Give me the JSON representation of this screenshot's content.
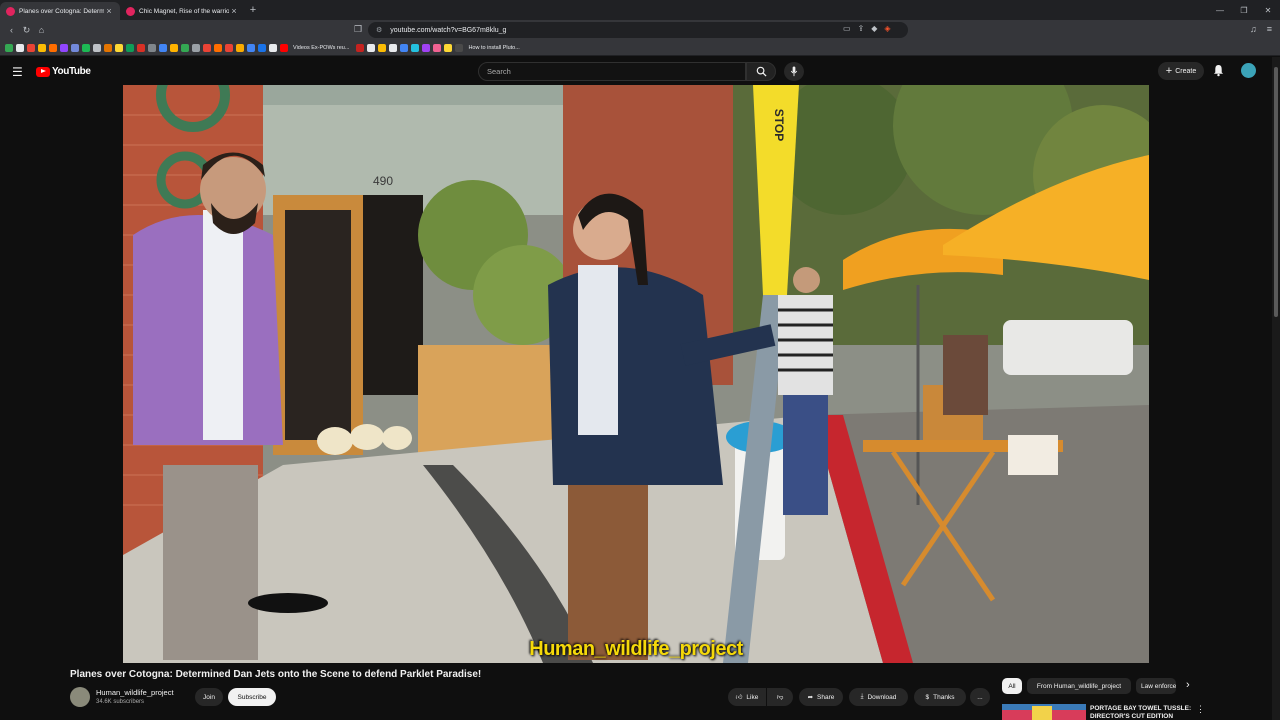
{
  "browser": {
    "tabs": [
      {
        "title": "Planes over Cotogna: Determ",
        "active": true
      },
      {
        "title": "Chic Magnet, Rise of the warrior wor",
        "active": false
      }
    ],
    "new_tab": "+",
    "url": "youtube.com/watch?v=BG67m8klu_g",
    "bookmarks": [
      {
        "label": "",
        "color": "#34a853"
      },
      {
        "label": "",
        "color": "#e8eaed"
      },
      {
        "label": "",
        "color": "#ea4335"
      },
      {
        "label": "",
        "color": "#fbbc04"
      },
      {
        "label": "",
        "color": "#ff6d00"
      },
      {
        "label": "",
        "color": "#9146ff"
      },
      {
        "label": "",
        "color": "#7289da"
      },
      {
        "label": "",
        "color": "#1db954"
      },
      {
        "label": "",
        "color": "#bdc1c6"
      },
      {
        "label": "",
        "color": "#e37400"
      },
      {
        "label": "",
        "color": "#fdd835"
      },
      {
        "label": "",
        "color": "#0f9d58"
      },
      {
        "label": "",
        "color": "#d93025"
      },
      {
        "label": "",
        "color": "#80868b"
      },
      {
        "label": "",
        "color": "#4285f4"
      },
      {
        "label": "",
        "color": "#ffb300"
      },
      {
        "label": "",
        "color": "#34a853"
      },
      {
        "label": "",
        "color": "#9aa0a6"
      },
      {
        "label": "",
        "color": "#ea4335"
      },
      {
        "label": "",
        "color": "#ff6d00"
      },
      {
        "label": "",
        "color": "#ea4335"
      },
      {
        "label": "",
        "color": "#f9ab00"
      },
      {
        "label": "",
        "color": "#4285f4"
      },
      {
        "label": "",
        "color": "#1a73e8"
      },
      {
        "label": "",
        "color": "#e8eaed"
      },
      {
        "label": "Videos Ex-POWs reu...",
        "color": "#ff0000"
      },
      {
        "label": "",
        "color": "#c5221f"
      },
      {
        "label": "",
        "color": "#e8eaed"
      },
      {
        "label": "",
        "color": "#fbbc04"
      },
      {
        "label": "",
        "color": "#e8eaed"
      },
      {
        "label": "",
        "color": "#4285f4"
      },
      {
        "label": "",
        "color": "#24c1e0"
      },
      {
        "label": "",
        "color": "#a142f4"
      },
      {
        "label": "",
        "color": "#f06292"
      },
      {
        "label": "",
        "color": "#fdd835"
      },
      {
        "label": "How to install Pluto...",
        "color": "#4a4a4a"
      }
    ]
  },
  "youtube": {
    "logo_text": "YouTube",
    "search_placeholder": "Search",
    "create_label": "Create",
    "video": {
      "title": "Planes over Cotogna: Determined Dan Jets onto the Scene to defend Parklet Paradise!",
      "caption": "Human_wildlife_project",
      "sign_text": "STOP",
      "address": "490"
    },
    "channel": {
      "name": "Human_wildlife_project",
      "subscribers": "34.6K subscribers",
      "join_label": "Join",
      "subscribe_label": "Subscribe"
    },
    "actions": {
      "like_label": "Like",
      "share_label": "Share",
      "download_label": "Download",
      "thanks_label": "Thanks",
      "more_label": "..."
    },
    "chips": [
      "All",
      "From Human_wildlife_project",
      "Law enforcement"
    ],
    "next_video": {
      "title": "PORTAGE BAY TOWEL TUSSLE: DIRECTOR'S CUT EDITION"
    }
  },
  "colors": {
    "accent_red": "#ff0000",
    "caption_yellow": "#f5d90a",
    "background": "#0f0f0f"
  }
}
